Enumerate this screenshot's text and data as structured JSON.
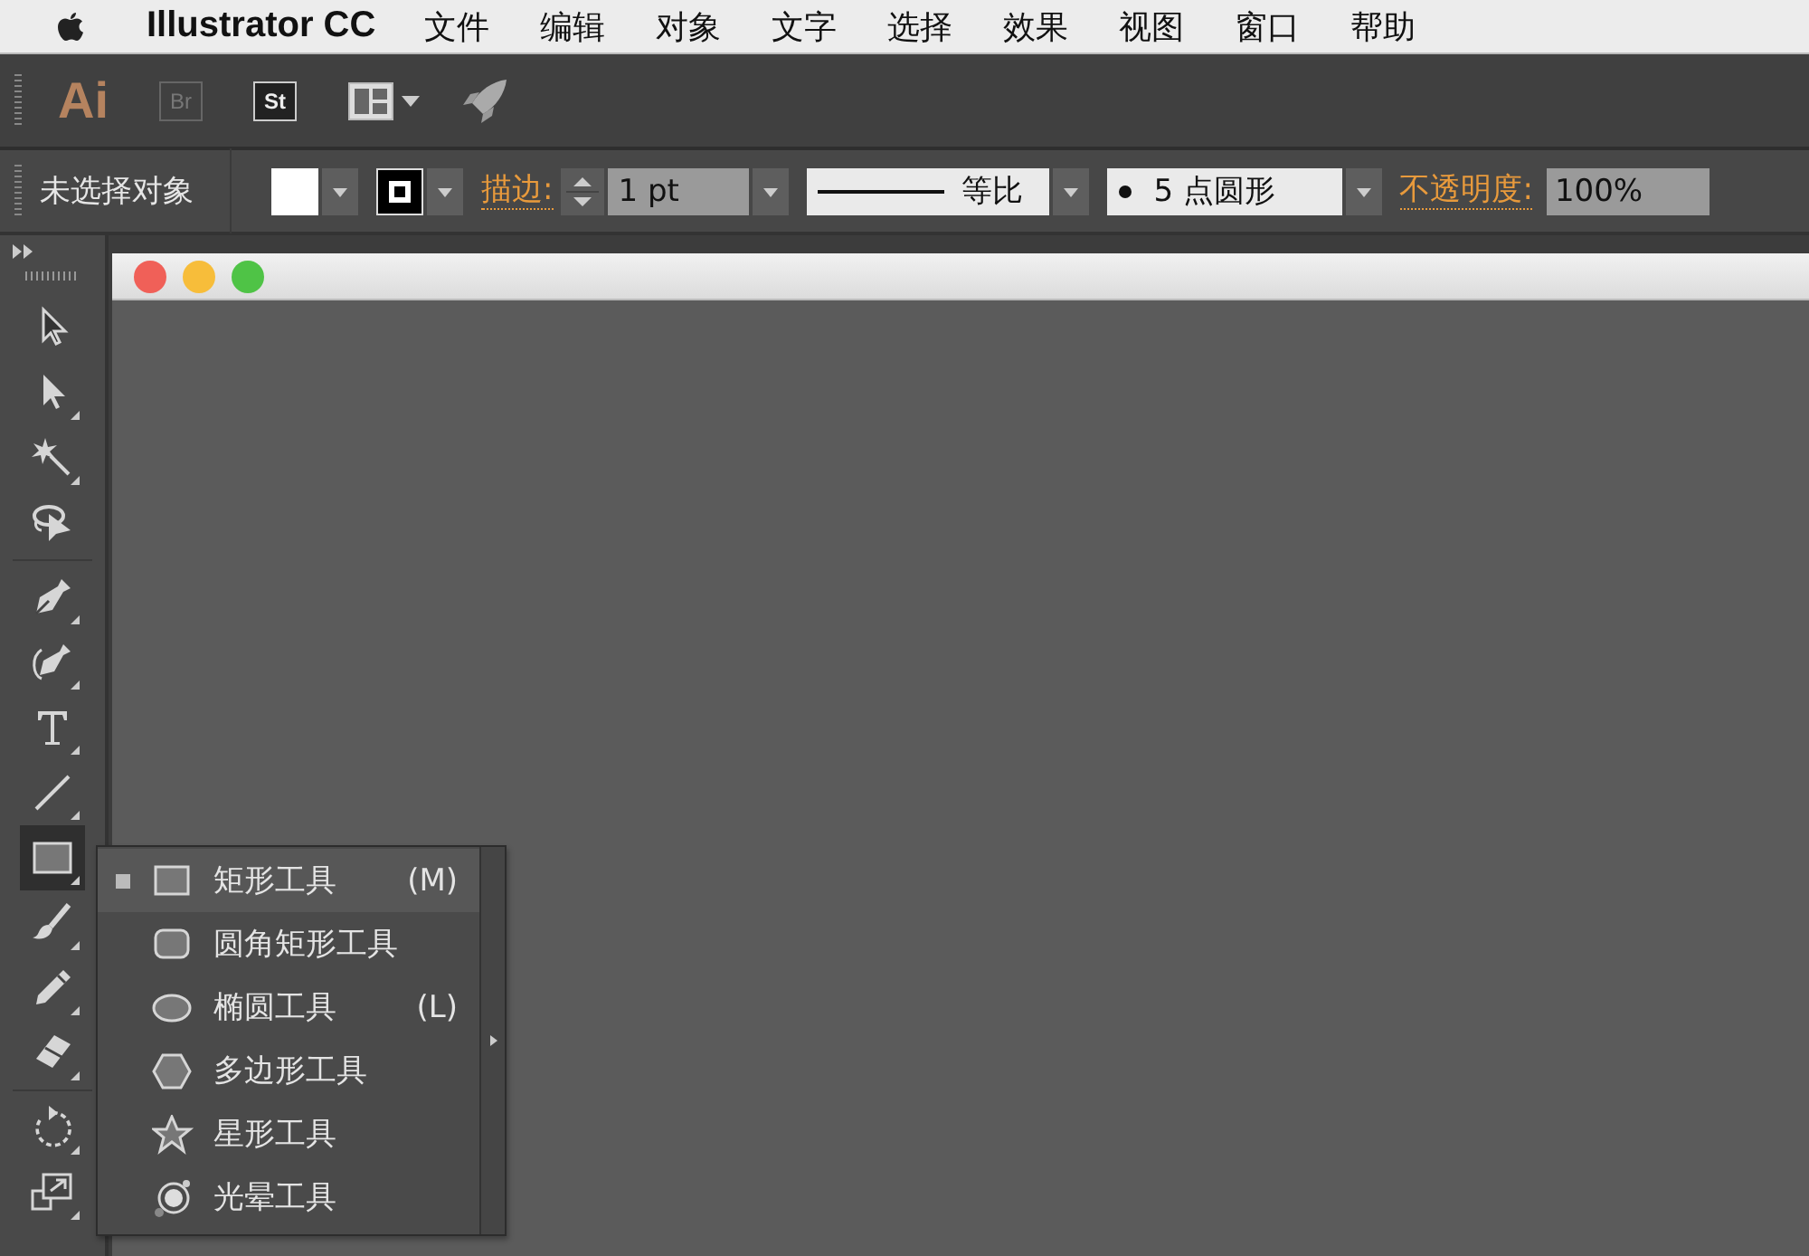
{
  "menu_bar": {
    "app_name": "Illustrator CC",
    "items": [
      "文件",
      "编辑",
      "对象",
      "文字",
      "选择",
      "效果",
      "视图",
      "窗口",
      "帮助"
    ]
  },
  "app_bar": {
    "logo": "Ai",
    "bridge": "Br",
    "stock": "St"
  },
  "control_bar": {
    "selection_status": "未选择对象",
    "stroke_label": "描边:",
    "stroke_weight": "1 pt",
    "stroke_profile": "等比",
    "brush": "5 点圆形",
    "opacity_label": "不透明度:",
    "opacity": "100%"
  },
  "tools": [
    {
      "selected": false
    },
    {
      "selected": false
    },
    {
      "selected": false
    },
    {
      "selected": false
    },
    {
      "selected": false
    },
    {
      "selected": false
    },
    {
      "selected": false
    },
    {
      "selected": false
    },
    {
      "selected": true
    },
    {
      "selected": false
    },
    {
      "selected": false
    },
    {
      "selected": false
    },
    {
      "selected": false
    },
    {
      "selected": false
    }
  ],
  "flyout": {
    "items": [
      {
        "label": "矩形工具",
        "shortcut": "(M)",
        "selected": true
      },
      {
        "label": "圆角矩形工具",
        "selected": false
      },
      {
        "label": "椭圆工具",
        "shortcut": "(L)",
        "selected": false
      },
      {
        "label": "多边形工具",
        "selected": false
      },
      {
        "label": "星形工具",
        "selected": false
      },
      {
        "label": "光晕工具",
        "selected": false
      }
    ]
  }
}
